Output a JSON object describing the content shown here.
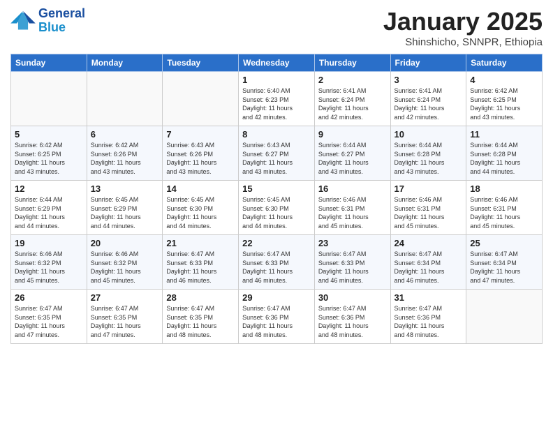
{
  "header": {
    "logo": {
      "general": "General",
      "blue": "Blue"
    },
    "title": "January 2025",
    "location": "Shinshicho, SNNPR, Ethiopia"
  },
  "weekdays": [
    "Sunday",
    "Monday",
    "Tuesday",
    "Wednesday",
    "Thursday",
    "Friday",
    "Saturday"
  ],
  "weeks": [
    [
      {
        "day": "",
        "info": ""
      },
      {
        "day": "",
        "info": ""
      },
      {
        "day": "",
        "info": ""
      },
      {
        "day": "1",
        "info": "Sunrise: 6:40 AM\nSunset: 6:23 PM\nDaylight: 11 hours\nand 42 minutes."
      },
      {
        "day": "2",
        "info": "Sunrise: 6:41 AM\nSunset: 6:24 PM\nDaylight: 11 hours\nand 42 minutes."
      },
      {
        "day": "3",
        "info": "Sunrise: 6:41 AM\nSunset: 6:24 PM\nDaylight: 11 hours\nand 42 minutes."
      },
      {
        "day": "4",
        "info": "Sunrise: 6:42 AM\nSunset: 6:25 PM\nDaylight: 11 hours\nand 43 minutes."
      }
    ],
    [
      {
        "day": "5",
        "info": "Sunrise: 6:42 AM\nSunset: 6:25 PM\nDaylight: 11 hours\nand 43 minutes."
      },
      {
        "day": "6",
        "info": "Sunrise: 6:42 AM\nSunset: 6:26 PM\nDaylight: 11 hours\nand 43 minutes."
      },
      {
        "day": "7",
        "info": "Sunrise: 6:43 AM\nSunset: 6:26 PM\nDaylight: 11 hours\nand 43 minutes."
      },
      {
        "day": "8",
        "info": "Sunrise: 6:43 AM\nSunset: 6:27 PM\nDaylight: 11 hours\nand 43 minutes."
      },
      {
        "day": "9",
        "info": "Sunrise: 6:44 AM\nSunset: 6:27 PM\nDaylight: 11 hours\nand 43 minutes."
      },
      {
        "day": "10",
        "info": "Sunrise: 6:44 AM\nSunset: 6:28 PM\nDaylight: 11 hours\nand 43 minutes."
      },
      {
        "day": "11",
        "info": "Sunrise: 6:44 AM\nSunset: 6:28 PM\nDaylight: 11 hours\nand 44 minutes."
      }
    ],
    [
      {
        "day": "12",
        "info": "Sunrise: 6:44 AM\nSunset: 6:29 PM\nDaylight: 11 hours\nand 44 minutes."
      },
      {
        "day": "13",
        "info": "Sunrise: 6:45 AM\nSunset: 6:29 PM\nDaylight: 11 hours\nand 44 minutes."
      },
      {
        "day": "14",
        "info": "Sunrise: 6:45 AM\nSunset: 6:30 PM\nDaylight: 11 hours\nand 44 minutes."
      },
      {
        "day": "15",
        "info": "Sunrise: 6:45 AM\nSunset: 6:30 PM\nDaylight: 11 hours\nand 44 minutes."
      },
      {
        "day": "16",
        "info": "Sunrise: 6:46 AM\nSunset: 6:31 PM\nDaylight: 11 hours\nand 45 minutes."
      },
      {
        "day": "17",
        "info": "Sunrise: 6:46 AM\nSunset: 6:31 PM\nDaylight: 11 hours\nand 45 minutes."
      },
      {
        "day": "18",
        "info": "Sunrise: 6:46 AM\nSunset: 6:31 PM\nDaylight: 11 hours\nand 45 minutes."
      }
    ],
    [
      {
        "day": "19",
        "info": "Sunrise: 6:46 AM\nSunset: 6:32 PM\nDaylight: 11 hours\nand 45 minutes."
      },
      {
        "day": "20",
        "info": "Sunrise: 6:46 AM\nSunset: 6:32 PM\nDaylight: 11 hours\nand 45 minutes."
      },
      {
        "day": "21",
        "info": "Sunrise: 6:47 AM\nSunset: 6:33 PM\nDaylight: 11 hours\nand 46 minutes."
      },
      {
        "day": "22",
        "info": "Sunrise: 6:47 AM\nSunset: 6:33 PM\nDaylight: 11 hours\nand 46 minutes."
      },
      {
        "day": "23",
        "info": "Sunrise: 6:47 AM\nSunset: 6:33 PM\nDaylight: 11 hours\nand 46 minutes."
      },
      {
        "day": "24",
        "info": "Sunrise: 6:47 AM\nSunset: 6:34 PM\nDaylight: 11 hours\nand 46 minutes."
      },
      {
        "day": "25",
        "info": "Sunrise: 6:47 AM\nSunset: 6:34 PM\nDaylight: 11 hours\nand 47 minutes."
      }
    ],
    [
      {
        "day": "26",
        "info": "Sunrise: 6:47 AM\nSunset: 6:35 PM\nDaylight: 11 hours\nand 47 minutes."
      },
      {
        "day": "27",
        "info": "Sunrise: 6:47 AM\nSunset: 6:35 PM\nDaylight: 11 hours\nand 47 minutes."
      },
      {
        "day": "28",
        "info": "Sunrise: 6:47 AM\nSunset: 6:35 PM\nDaylight: 11 hours\nand 48 minutes."
      },
      {
        "day": "29",
        "info": "Sunrise: 6:47 AM\nSunset: 6:36 PM\nDaylight: 11 hours\nand 48 minutes."
      },
      {
        "day": "30",
        "info": "Sunrise: 6:47 AM\nSunset: 6:36 PM\nDaylight: 11 hours\nand 48 minutes."
      },
      {
        "day": "31",
        "info": "Sunrise: 6:47 AM\nSunset: 6:36 PM\nDaylight: 11 hours\nand 48 minutes."
      },
      {
        "day": "",
        "info": ""
      }
    ]
  ]
}
